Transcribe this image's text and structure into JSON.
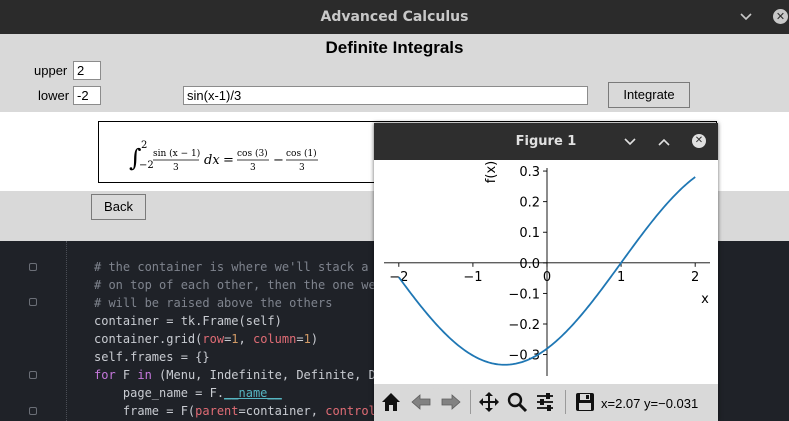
{
  "window": {
    "title": "Advanced Calculus",
    "colors": {
      "titlebar": "#2b2b2b",
      "panel": "#d9d9d9"
    }
  },
  "page": {
    "heading": "Definite Integrals",
    "upper_label": "upper",
    "upper_value": "2",
    "lower_label": "lower",
    "lower_value": "-2",
    "expression_value": "sin(x-1)/3",
    "integrate_label": "Integrate",
    "back_label": "Back",
    "result": {
      "upper_limit": "2",
      "lower_limit": "−2",
      "integrand_num": "sin (x − 1)",
      "integrand_den": "3",
      "dx": "dx",
      "equals": "=",
      "term1_num": "cos (3)",
      "term1_den": "3",
      "minus": "−",
      "term2_num": "cos (1)",
      "term2_den": "3"
    }
  },
  "editor": {
    "lines": [
      {
        "parts": [
          {
            "t": "# the container is where we'll stack a b",
            "c": "comment"
          }
        ]
      },
      {
        "parts": [
          {
            "t": "# on top of each other, then the one we",
            "c": "comment"
          }
        ]
      },
      {
        "parts": [
          {
            "t": "# will be raised above the others",
            "c": "comment"
          }
        ]
      },
      {
        "parts": [
          {
            "t": "container = tk.Frame(self)",
            "c": ""
          }
        ]
      },
      {
        "parts": [
          {
            "t": "container.grid(",
            "c": ""
          },
          {
            "t": "row",
            "c": "param"
          },
          {
            "t": "=",
            "c": ""
          },
          {
            "t": "1",
            "c": "num"
          },
          {
            "t": ", ",
            "c": ""
          },
          {
            "t": "column",
            "c": "param"
          },
          {
            "t": "=",
            "c": ""
          },
          {
            "t": "1",
            "c": "num"
          },
          {
            "t": ")",
            "c": ""
          }
        ]
      },
      {
        "parts": [
          {
            "t": "self.frames = {}",
            "c": ""
          }
        ]
      },
      {
        "parts": [
          {
            "t": "for",
            "c": "kw"
          },
          {
            "t": " F ",
            "c": ""
          },
          {
            "t": "in",
            "c": "kw"
          },
          {
            "t": " (Menu, Indefinite, Definite, Di",
            "c": ""
          }
        ]
      },
      {
        "parts": [
          {
            "t": "    page_name = F.",
            "c": ""
          },
          {
            "t": "__name__",
            "c": "dunder"
          }
        ]
      },
      {
        "parts": [
          {
            "t": "    frame = F(",
            "c": ""
          },
          {
            "t": "parent",
            "c": "param"
          },
          {
            "t": "=container, ",
            "c": ""
          },
          {
            "t": "controll",
            "c": "param"
          }
        ]
      }
    ]
  },
  "figure": {
    "title": "Figure 1",
    "coords_text": "x=2.07 y=−0.031",
    "toolbar_icons": [
      "home-icon",
      "back-icon",
      "forward-icon",
      "pan-icon",
      "zoom-icon",
      "configure-icon",
      "save-icon"
    ]
  },
  "chart_data": {
    "type": "line",
    "function": "sin(x-1)/3",
    "title": "",
    "xlabel": "x",
    "ylabel": "f(x)",
    "xlim": [
      -2.2,
      2.2
    ],
    "ylim": [
      -0.37,
      0.31
    ],
    "xticks": [
      -2,
      -1,
      0,
      1,
      2
    ],
    "xtick_labels": [
      "−2",
      "−1",
      "0",
      "1",
      "2"
    ],
    "yticks": [
      0.3,
      0.2,
      0.1,
      0.0,
      -0.1,
      -0.2,
      -0.3
    ],
    "ytick_labels": [
      "0.3",
      "0.2",
      "0.1",
      "0.0",
      "−0.1",
      "−0.2",
      "−0.3"
    ],
    "spines": "centered",
    "line_color": "#1f77b4",
    "grid": false
  }
}
